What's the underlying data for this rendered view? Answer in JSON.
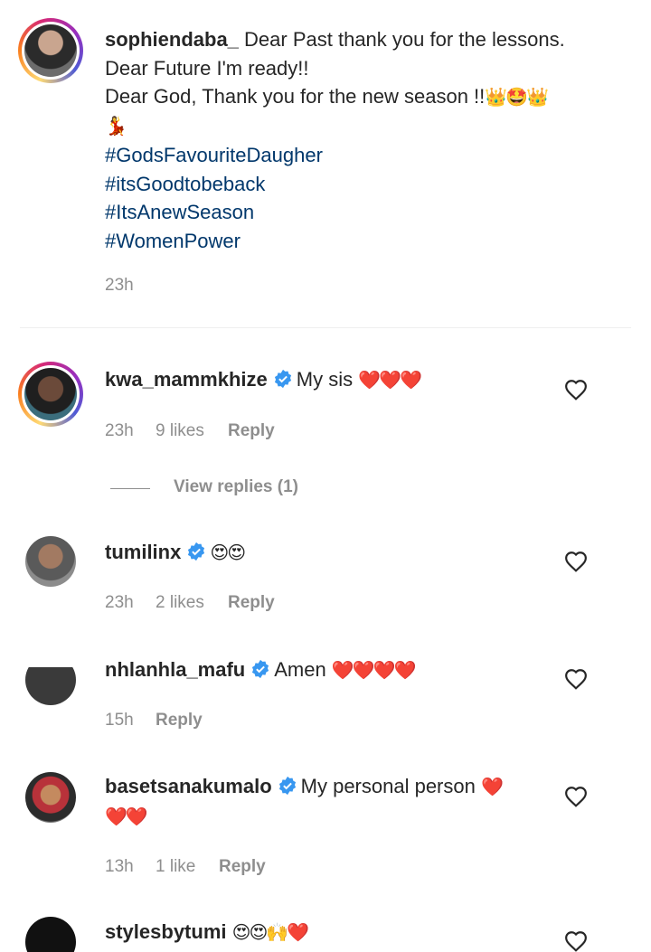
{
  "caption": {
    "username": "sophiendaba_",
    "line1": "Dear Past thank you for the lessons.",
    "line2": "Dear Future I'm ready!!",
    "line3": "Dear God, Thank you for the new season !!",
    "line3_emoji": "👑🤩👑",
    "line4_emoji": "💃",
    "hashtags": [
      "#GodsFavouriteDaugher",
      "#itsGoodtobeback",
      "#ItsAnewSeason",
      "#WomenPower"
    ],
    "time": "23h"
  },
  "comments": [
    {
      "username": "kwa_mammkhize",
      "verified": true,
      "text": "My sis",
      "emoji": "❤️❤️❤️",
      "time": "23h",
      "likes": "9 likes",
      "reply": "Reply"
    },
    {
      "username": "tumilinx",
      "verified": true,
      "text": "",
      "emoji": "😍😍",
      "time": "23h",
      "likes": "2 likes",
      "reply": "Reply"
    },
    {
      "username": "nhlanhla_mafu",
      "verified": true,
      "text": "Amen",
      "emoji": "❤️❤️❤️❤️",
      "time": "15h",
      "likes": "",
      "reply": "Reply"
    },
    {
      "username": "basetsanakumalo",
      "verified": true,
      "text": "My personal person",
      "emoji": "❤️",
      "emoji2": "❤️❤️",
      "time": "13h",
      "likes": "1 like",
      "reply": "Reply"
    },
    {
      "username": "stylesbytumi",
      "verified": false,
      "text": "",
      "emoji": "😍😍🙌❤️",
      "time": "",
      "likes": "",
      "reply": ""
    }
  ],
  "view_replies": "View replies (1)",
  "colors": {
    "text": "#262626",
    "secondary": "#8e8e8e",
    "hashtag": "#00376b",
    "verified": "#3897f0",
    "heart": "#ed4956"
  },
  "icons": {
    "like": "heart-outline-icon",
    "verified": "verified-badge-icon"
  }
}
